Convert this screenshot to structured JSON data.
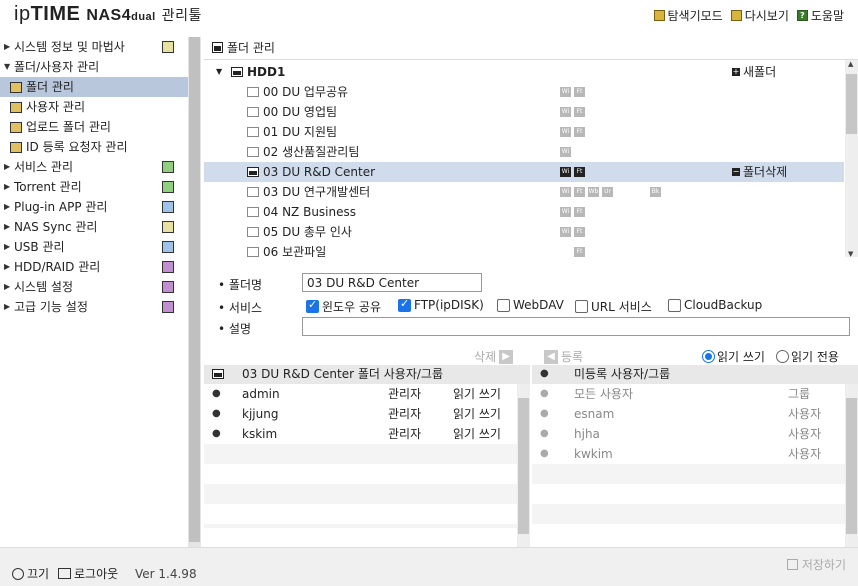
{
  "app": {
    "brand_ip": "ip",
    "brand_time": "TIME",
    "brand_nas": "NAS4",
    "brand_dual": "dual",
    "brand_tool": "관리툴"
  },
  "toplinks": {
    "explore": "탐색기모드",
    "refresh": "다시보기",
    "help": "도움말"
  },
  "sidebar": {
    "items": [
      {
        "label": "시스템 정보 및 마법사"
      },
      {
        "label": "폴더/사용자 관리"
      },
      {
        "label": "폴더 관리"
      },
      {
        "label": "사용자 관리"
      },
      {
        "label": "업로드 폴더 관리"
      },
      {
        "label": "ID 등록 요청자 관리"
      },
      {
        "label": "서비스 관리"
      },
      {
        "label": "Torrent 관리"
      },
      {
        "label": "Plug-in APP 관리"
      },
      {
        "label": "NAS Sync 관리"
      },
      {
        "label": "USB 관리"
      },
      {
        "label": "HDD/RAID 관리"
      },
      {
        "label": "시스템 설정"
      },
      {
        "label": "고급 기능 설정"
      }
    ]
  },
  "bottom": {
    "power": "끄기",
    "logout": "로그아웃",
    "version": "Ver 1.4.98",
    "save": "저장하기"
  },
  "main": {
    "title": "폴더 관리",
    "tree": {
      "root": "HDD1",
      "new_folder": "새폴더",
      "delete_folder": "폴더삭제",
      "folders": [
        {
          "name": "00 DU 업무공유"
        },
        {
          "name": "00 DU 영업팀"
        },
        {
          "name": "01 DU 지원팀"
        },
        {
          "name": "02 생산품질관리팀"
        },
        {
          "name": "03 DU R&D Center"
        },
        {
          "name": "03 DU 연구개발센터"
        },
        {
          "name": "04 NZ Business"
        },
        {
          "name": "05 DU 총무 인사"
        },
        {
          "name": "06 보관파일"
        }
      ]
    },
    "props": {
      "folder_name_label": "폴더명",
      "folder_name_value": "03 DU R&D Center",
      "service_label": "서비스",
      "desc_label": "설명",
      "services": [
        "윈도우 공유",
        "FTP(ipDISK)",
        "WebDAV",
        "URL 서비스",
        "CloudBackup"
      ],
      "services_checked": [
        true,
        true,
        false,
        false,
        false
      ]
    },
    "actions": {
      "delete": "삭제",
      "register": "등록",
      "read_write": "읽기 쓰기",
      "read_only": "읽기 전용"
    },
    "left_panel": {
      "title": "03 DU R&D Center 폴더 사용자/그룹",
      "users": [
        {
          "name": "admin",
          "role": "관리자",
          "perm": "읽기 쓰기"
        },
        {
          "name": "kjjung",
          "role": "관리자",
          "perm": "읽기 쓰기"
        },
        {
          "name": "kskim",
          "role": "관리자",
          "perm": "읽기 쓰기"
        }
      ]
    },
    "right_panel": {
      "title": "미등록 사용자/그룹",
      "users": [
        {
          "name": "모든 사용자",
          "type": "그룹"
        },
        {
          "name": "esnam",
          "type": "사용자"
        },
        {
          "name": "hjha",
          "type": "사용자"
        },
        {
          "name": "kwkim",
          "type": "사용자"
        }
      ]
    }
  },
  "colors": {
    "selected_row": "#d0dcec",
    "accent": "#1a73e8",
    "sidebar_selected": "#b9c7dd"
  }
}
